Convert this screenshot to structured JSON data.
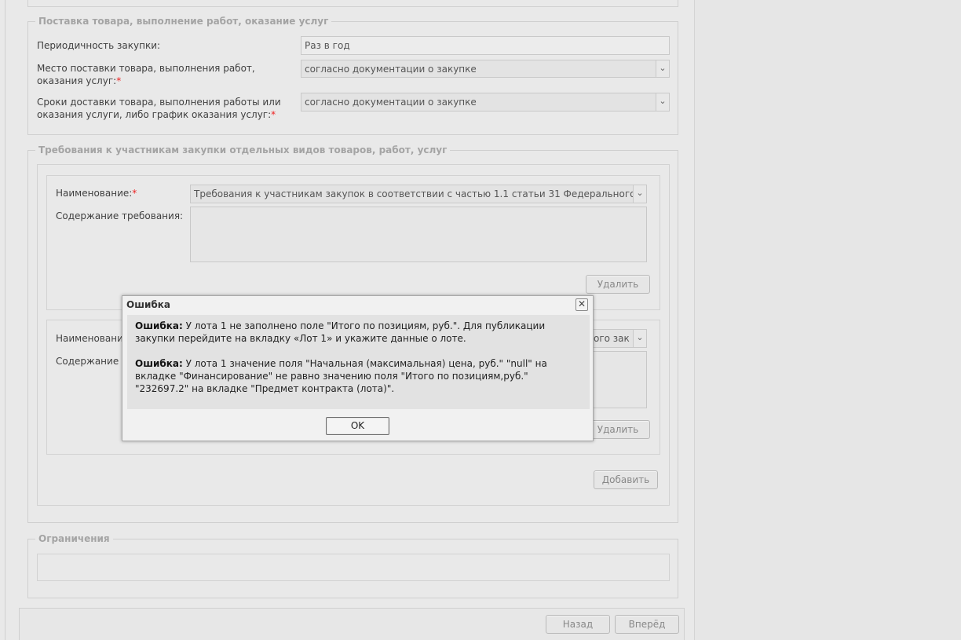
{
  "delivery": {
    "legend": "Поставка товара, выполнение работ, оказание услуг",
    "periodicity_label": "Периодичность закупки:",
    "periodicity_value": "Раз в год",
    "place_label": "Место поставки товара, выполнения работ, оказания услуг:",
    "place_value": "согласно документации о закупке",
    "terms_label": "Сроки доставки товара, выполнения работы или оказания услуги, либо график оказания услуг:",
    "terms_value": "согласно документации о закупке"
  },
  "requirements": {
    "legend": "Требования к участникам закупки отдельных видов товаров, работ, услуг",
    "item1": {
      "name_label": "Наименование:",
      "name_value": "Требования к участникам закупок в соответствии с частью 1.1 статьи 31 Федерального за",
      "content_label": "Содержание требования:",
      "delete_label": "Удалить"
    },
    "item2": {
      "name_label_partial": "Наименовани",
      "name_value_partial": "ого зак",
      "content_label_partial": "Содержание т",
      "delete_label": "Удалить"
    },
    "add_label": "Добавить"
  },
  "restrictions": {
    "legend": "Ограничения"
  },
  "footer": {
    "back_label": "Назад",
    "next_label": "Вперёд"
  },
  "modal": {
    "title": "Ошибка",
    "close_glyph": "✕",
    "msg1_prefix": "Ошибка:",
    "msg1_text": " У лота 1 не заполнено поле \"Итого по позициям, руб.\". Для публикации закупки перейдите на вкладку «Лот 1» и укажите данные о лоте.",
    "msg2_prefix": "Ошибка:",
    "msg2_text": " У лота 1 значение поля \"Начальная (максимальная) цена, руб.\" \"null\" на вкладке \"Финансирование\" не равно значению поля \"Итого по позициям,руб.\" \"232697.2\" на вкладке \"Предмет контракта (лота)\".",
    "ok_label": "OK"
  },
  "colors": {
    "required_marker": "#e22222",
    "legend_text": "#a4a4a4"
  },
  "icons": {
    "dropdown": "chevron-down-icon",
    "close": "close-icon"
  }
}
